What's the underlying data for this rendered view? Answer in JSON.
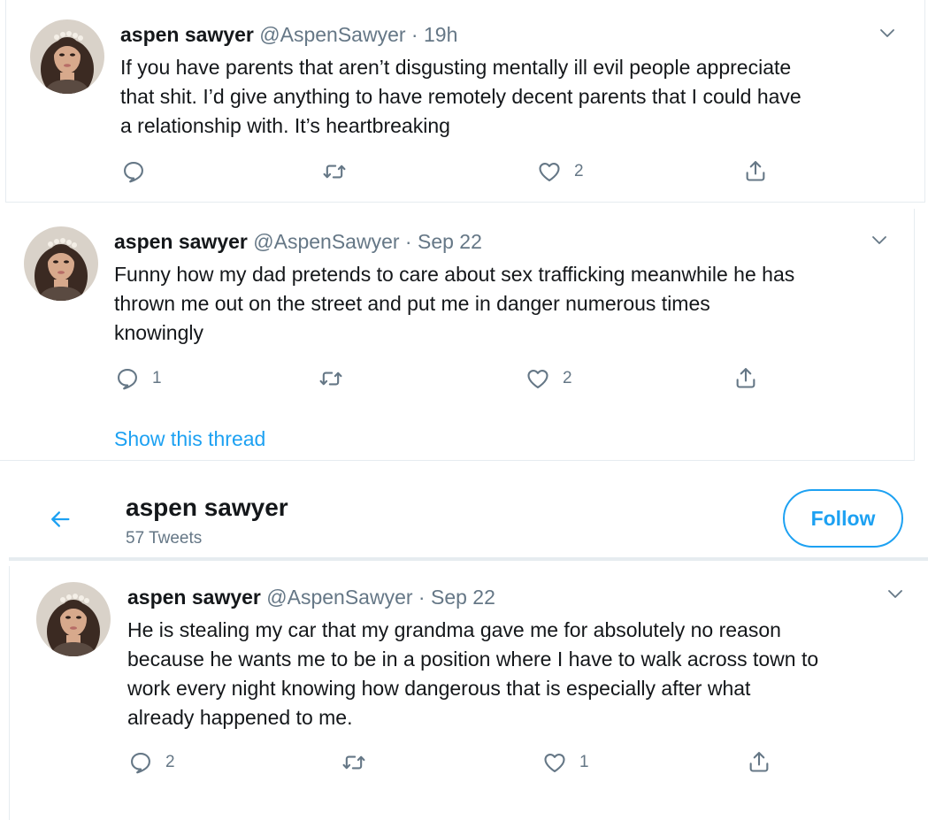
{
  "colors": {
    "accent": "#1da1f2",
    "text": "#14171a",
    "muted": "#657786",
    "border": "#e6ecf0"
  },
  "tweets": [
    {
      "name": "aspen sawyer",
      "handle": "@AspenSawyer",
      "time": "19h",
      "lines": [
        "If you have parents that aren’t disgusting mentally ill evil people appreciate",
        "that shit. I’d give anything to have remotely decent parents that I could have",
        "a relationship with. It’s heartbreaking"
      ],
      "replies": "",
      "retweets": "",
      "likes": "2"
    },
    {
      "name": "aspen sawyer",
      "handle": "@AspenSawyer",
      "time": "Sep 22",
      "lines": [
        "Funny how my dad pretends to care about sex trafficking meanwhile he has",
        "thrown me out on the street and put me in danger numerous times",
        "knowingly"
      ],
      "replies": "1",
      "retweets": "",
      "likes": "2",
      "show_thread": "Show this thread"
    },
    {
      "name": "aspen sawyer",
      "handle": "@AspenSawyer",
      "time": "Sep 22",
      "lines": [
        "He is stealing my car that my grandma gave me for absolutely no reason",
        "because he wants me to be in a position where I have to walk across town to",
        "work every night knowing how dangerous that is especially after what",
        "already happened to me."
      ],
      "replies": "2",
      "retweets": "",
      "likes": "1"
    }
  ],
  "profile_header": {
    "name": "aspen sawyer",
    "tweet_count": "57 Tweets",
    "follow_label": "Follow"
  },
  "icons": [
    "back-arrow-icon",
    "reply-icon",
    "retweet-icon",
    "like-icon",
    "share-icon",
    "chevron-down-icon"
  ]
}
